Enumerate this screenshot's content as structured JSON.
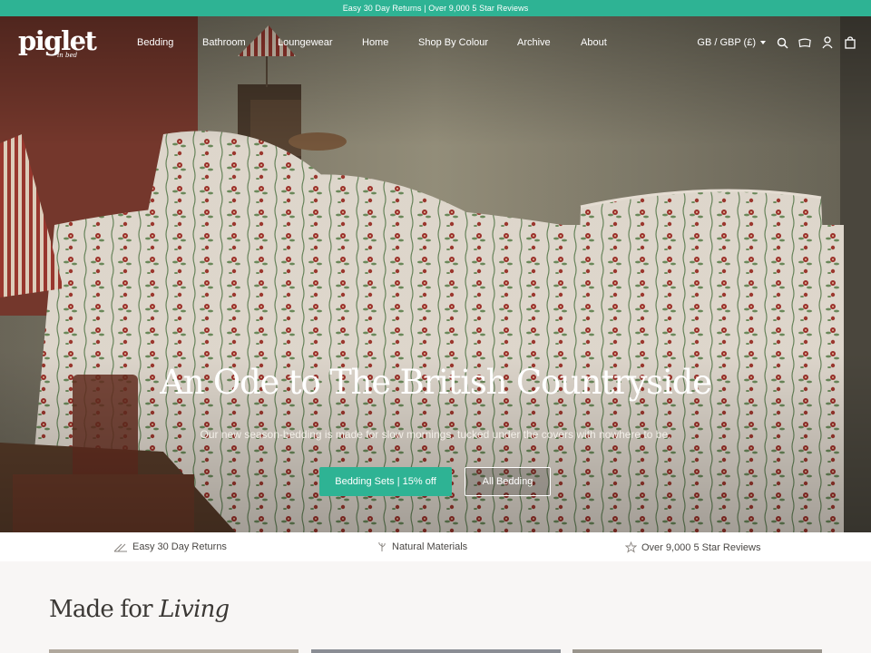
{
  "announcement": "Easy 30 Day Returns | Over 9,000 5 Star Reviews",
  "logo": {
    "word": "piglet",
    "sub": "in bed"
  },
  "nav": {
    "items": [
      "Bedding",
      "Bathroom",
      "Loungewear",
      "Home",
      "Shop By Colour",
      "Archive",
      "About"
    ],
    "locale": "GB / GBP (£)",
    "icons": [
      "search-icon",
      "bed-icon",
      "account-icon",
      "bag-icon"
    ]
  },
  "hero": {
    "title": "An Ode to The British Countryside",
    "subtitle": "Our new season-bedding is made for slow mornings, tucked under the covers with nowhere to be.",
    "primary_button": "Bedding Sets | 15% off",
    "secondary_button": "All Bedding"
  },
  "trust": [
    "Easy 30 Day Returns",
    "Natural Materials",
    "Over 9,000 5 Star Reviews"
  ],
  "section": {
    "title_plain": "Made for",
    "title_italic": "Living"
  },
  "colors": {
    "brand_green": "#2eb394",
    "headboard": "#7a3a2e",
    "text_dark": "#3b3835"
  }
}
